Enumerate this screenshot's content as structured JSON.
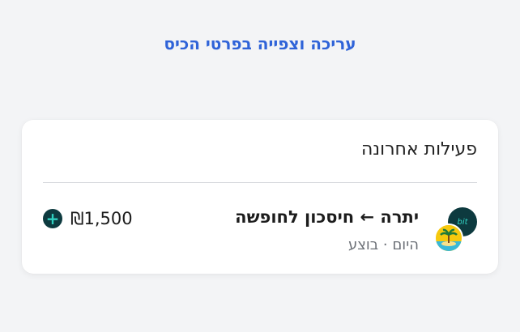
{
  "header": {
    "edit_link": "עריכה וצפייה בפרטי הכיס"
  },
  "recent": {
    "title": "פעילות אחרונה",
    "items": [
      {
        "title": "יתרה ← חיסכון לחופשה",
        "subtitle": "היום · בוצע",
        "amount": "₪1,500",
        "badge": "bit",
        "icon": "palm-tree-icon",
        "direction_icon": "plus-icon"
      }
    ]
  },
  "colors": {
    "accent": "#2f63d8",
    "badge_bg": "#0d3a3f",
    "badge_fg": "#33d6c6",
    "background": "#f3f4f6"
  }
}
